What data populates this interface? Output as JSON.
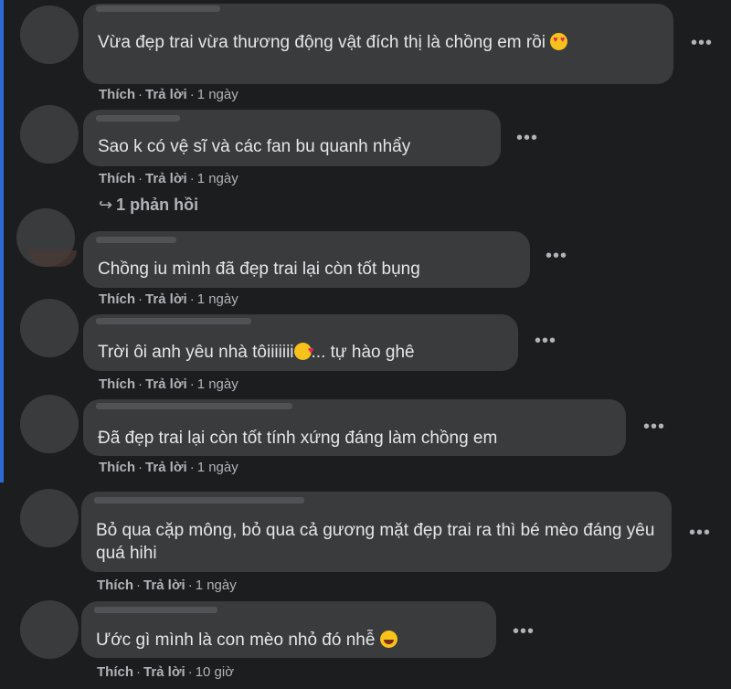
{
  "comments": [
    {
      "text": "Vừa đẹp trai vừa thương động vật đích thị là chồng em rồi",
      "emoji": "heart-eyes-emoji",
      "like": "Thích",
      "reply": "Trả lời",
      "time": "1 ngày"
    },
    {
      "text": "Sao k có vệ sĩ và các fan bu quanh nhẩy",
      "like": "Thích",
      "reply": "Trả lời",
      "time": "1 ngày",
      "replies_label": "1 phản hồi"
    },
    {
      "text": "Chồng iu mình đã đẹp trai lại còn tốt bụng",
      "like": "Thích",
      "reply": "Trả lời",
      "time": "1 ngày"
    },
    {
      "text": "Trời ôi anh yêu nhà tôiiiiiii",
      "text_after": "... tự hào ghê",
      "emoji": "smiling-hearts-emoji",
      "like": "Thích",
      "reply": "Trả lời",
      "time": "1 ngày"
    },
    {
      "text": "Đã đẹp trai lại còn tốt tính xứng đáng làm chồng em",
      "like": "Thích",
      "reply": "Trả lời",
      "time": "1 ngày"
    },
    {
      "text": "Bỏ qua cặp mông, bỏ qua cả gương mặt đẹp trai ra thì bé mèo đáng yêu quá hihi",
      "like": "Thích",
      "reply": "Trả lời",
      "time": "1 ngày"
    },
    {
      "text": "Ước gì mình là con mèo nhỏ đó nhễ",
      "emoji": "rolling-laughing-emoji",
      "like": "Thích",
      "reply": "Trả lời",
      "time": "10 giờ"
    }
  ],
  "more_glyph": "•••",
  "reply_arrow": "↪",
  "colors": {
    "background": "#1c1d1f",
    "bubble": "#3a3b3c",
    "text": "#e4e6eb",
    "secondary": "#b0b3b8",
    "edge_accent": "#2d6bd8"
  }
}
